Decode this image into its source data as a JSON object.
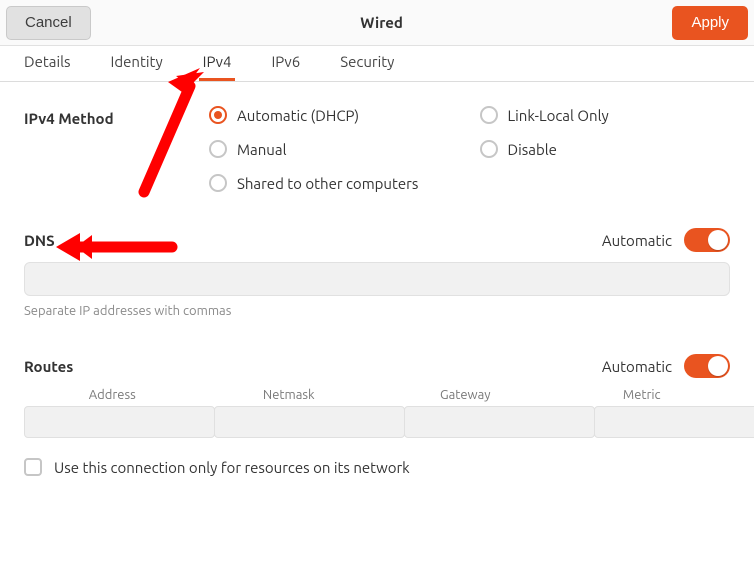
{
  "header": {
    "cancel_label": "Cancel",
    "title": "Wired",
    "apply_label": "Apply"
  },
  "tabs": {
    "details": "Details",
    "identity": "Identity",
    "ipv4": "IPv4",
    "ipv6": "IPv6",
    "security": "Security"
  },
  "ipv4": {
    "method_label": "IPv4 Method",
    "methods": {
      "auto_dhcp": "Automatic (DHCP)",
      "link_local": "Link-Local Only",
      "manual": "Manual",
      "disable": "Disable",
      "shared": "Shared to other computers",
      "selected": "auto_dhcp"
    }
  },
  "dns": {
    "label": "DNS",
    "automatic_label": "Automatic",
    "automatic_on": true,
    "value": "",
    "helper": "Separate IP addresses with commas"
  },
  "routes": {
    "label": "Routes",
    "automatic_label": "Automatic",
    "automatic_on": true,
    "columns": {
      "address": "Address",
      "netmask": "Netmask",
      "gateway": "Gateway",
      "metric": "Metric"
    },
    "rows": [
      {
        "address": "",
        "netmask": "",
        "gateway": "",
        "metric": ""
      }
    ],
    "use_only_for_resources_label": "Use this connection only for resources on its network",
    "use_only_for_resources_checked": false
  },
  "icons": {
    "trash": "trash-icon"
  }
}
